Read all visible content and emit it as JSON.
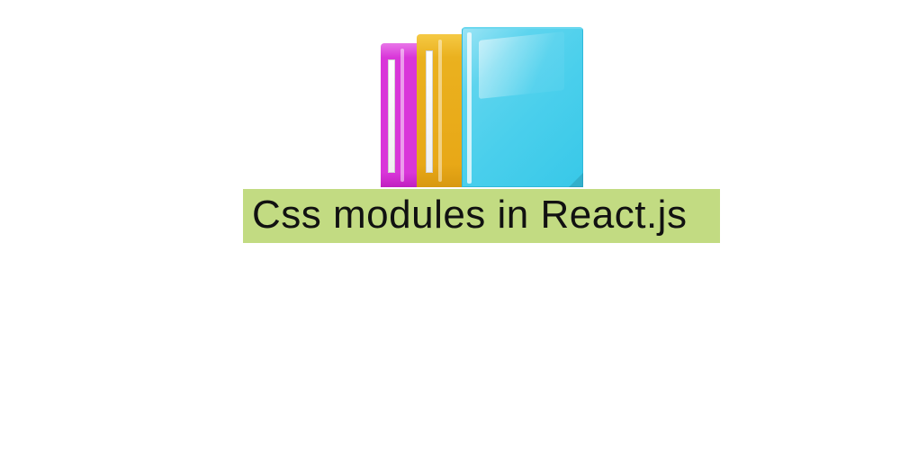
{
  "title": "Css modules in React.js",
  "folders": {
    "magenta": {
      "color": "#d936d9"
    },
    "orange": {
      "color": "#eab11f"
    },
    "cyan": {
      "color": "#4acfec"
    }
  }
}
